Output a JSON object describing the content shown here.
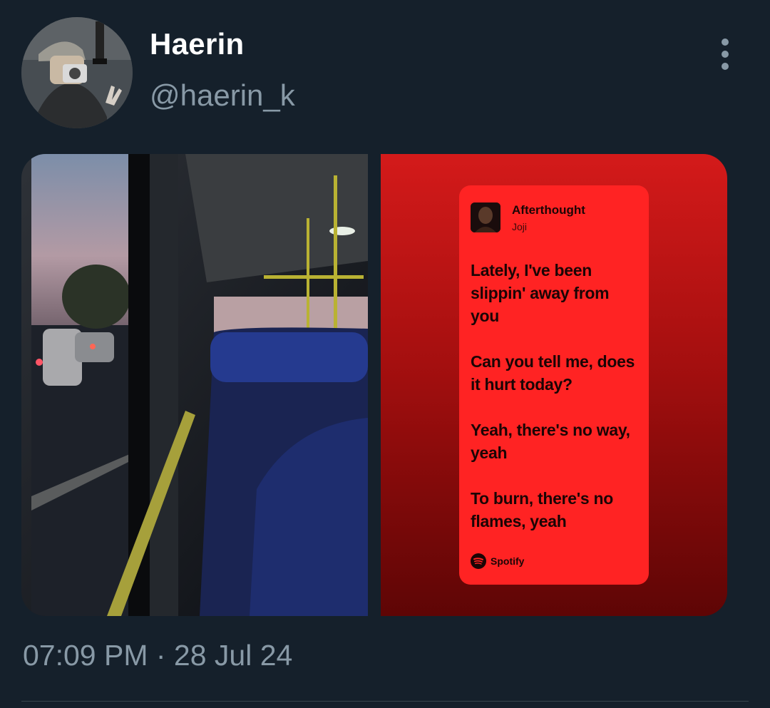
{
  "tweet": {
    "display_name": "Haerin",
    "handle": "@haerin_k",
    "avatar_icon": "avatar-photo",
    "more_icon": "vertical-ellipsis-icon",
    "timestamp": "07:09 PM · 28 Jul 24"
  },
  "media": {
    "left_photo": "bus-interior-photo",
    "right_card": {
      "song_title": "Afterthought",
      "artist": "Joji",
      "lyrics": [
        "Lately, I've been slippin' away from you",
        "Can you tell me, does it hurt today?",
        "Yeah, there's no way, yeah",
        "To burn, there's no flames, yeah"
      ],
      "brand": "Spotify",
      "brand_icon": "spotify-icon"
    }
  },
  "colors": {
    "background": "#15202b",
    "secondary_text": "#8899a6",
    "card_red": "#ff2323"
  }
}
